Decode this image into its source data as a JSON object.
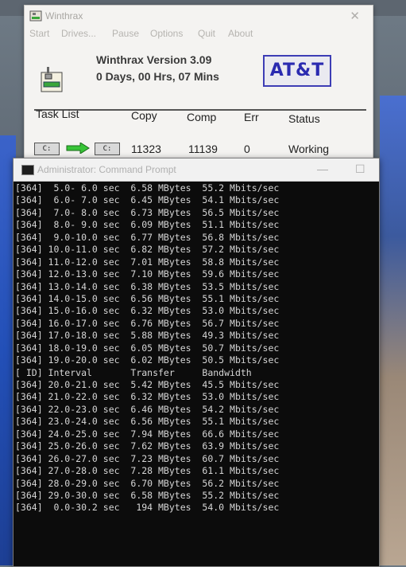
{
  "winthrax": {
    "title": "Winthrax",
    "menu": [
      "Start",
      "Drives...",
      "Pause",
      "Options",
      "Quit",
      "About"
    ],
    "version": "Winthrax Version 3.09",
    "uptime": "0 Days, 00 Hrs, 07 Mins",
    "logo": "AT&T",
    "columns": {
      "task_list": "Task List",
      "copy": "Copy",
      "comp": "Comp",
      "err": "Err",
      "status": "Status"
    },
    "task": {
      "src_drive": "C:",
      "dst_drive": "C:",
      "copy": "11323",
      "comp": "11139",
      "err": "0",
      "status": "Working"
    }
  },
  "cmd": {
    "title": "Administrator: Command Prompt",
    "lines": [
      "[364]  5.0- 6.0 sec  6.58 MBytes  55.2 Mbits/sec",
      "[364]  6.0- 7.0 sec  6.45 MBytes  54.1 Mbits/sec",
      "[364]  7.0- 8.0 sec  6.73 MBytes  56.5 Mbits/sec",
      "[364]  8.0- 9.0 sec  6.09 MBytes  51.1 Mbits/sec",
      "[364]  9.0-10.0 sec  6.77 MBytes  56.8 Mbits/sec",
      "[364] 10.0-11.0 sec  6.82 MBytes  57.2 Mbits/sec",
      "[364] 11.0-12.0 sec  7.01 MBytes  58.8 Mbits/sec",
      "[364] 12.0-13.0 sec  7.10 MBytes  59.6 Mbits/sec",
      "[364] 13.0-14.0 sec  6.38 MBytes  53.5 Mbits/sec",
      "[364] 14.0-15.0 sec  6.56 MBytes  55.1 Mbits/sec",
      "[364] 15.0-16.0 sec  6.32 MBytes  53.0 Mbits/sec",
      "[364] 16.0-17.0 sec  6.76 MBytes  56.7 Mbits/sec",
      "[364] 17.0-18.0 sec  5.88 MBytes  49.3 Mbits/sec",
      "[364] 18.0-19.0 sec  6.05 MBytes  50.7 Mbits/sec",
      "[364] 19.0-20.0 sec  6.02 MBytes  50.5 Mbits/sec",
      "[ ID] Interval       Transfer     Bandwidth",
      "[364] 20.0-21.0 sec  5.42 MBytes  45.5 Mbits/sec",
      "[364] 21.0-22.0 sec  6.32 MBytes  53.0 Mbits/sec",
      "[364] 22.0-23.0 sec  6.46 MBytes  54.2 Mbits/sec",
      "[364] 23.0-24.0 sec  6.56 MBytes  55.1 Mbits/sec",
      "[364] 24.0-25.0 sec  7.94 MBytes  66.6 Mbits/sec",
      "[364] 25.0-26.0 sec  7.62 MBytes  63.9 Mbits/sec",
      "[364] 26.0-27.0 sec  7.23 MBytes  60.7 Mbits/sec",
      "[364] 27.0-28.0 sec  7.28 MBytes  61.1 Mbits/sec",
      "[364] 28.0-29.0 sec  6.70 MBytes  56.2 Mbits/sec",
      "[364] 29.0-30.0 sec  6.58 MBytes  55.2 Mbits/sec",
      "[364]  0.0-30.2 sec   194 MBytes  54.0 Mbits/sec"
    ]
  },
  "colors": {
    "logo_blue": "#2b2bb0",
    "arrow_green": "#37c437",
    "console_bg": "#0c0c0c",
    "console_fg": "#d6d6d6"
  }
}
